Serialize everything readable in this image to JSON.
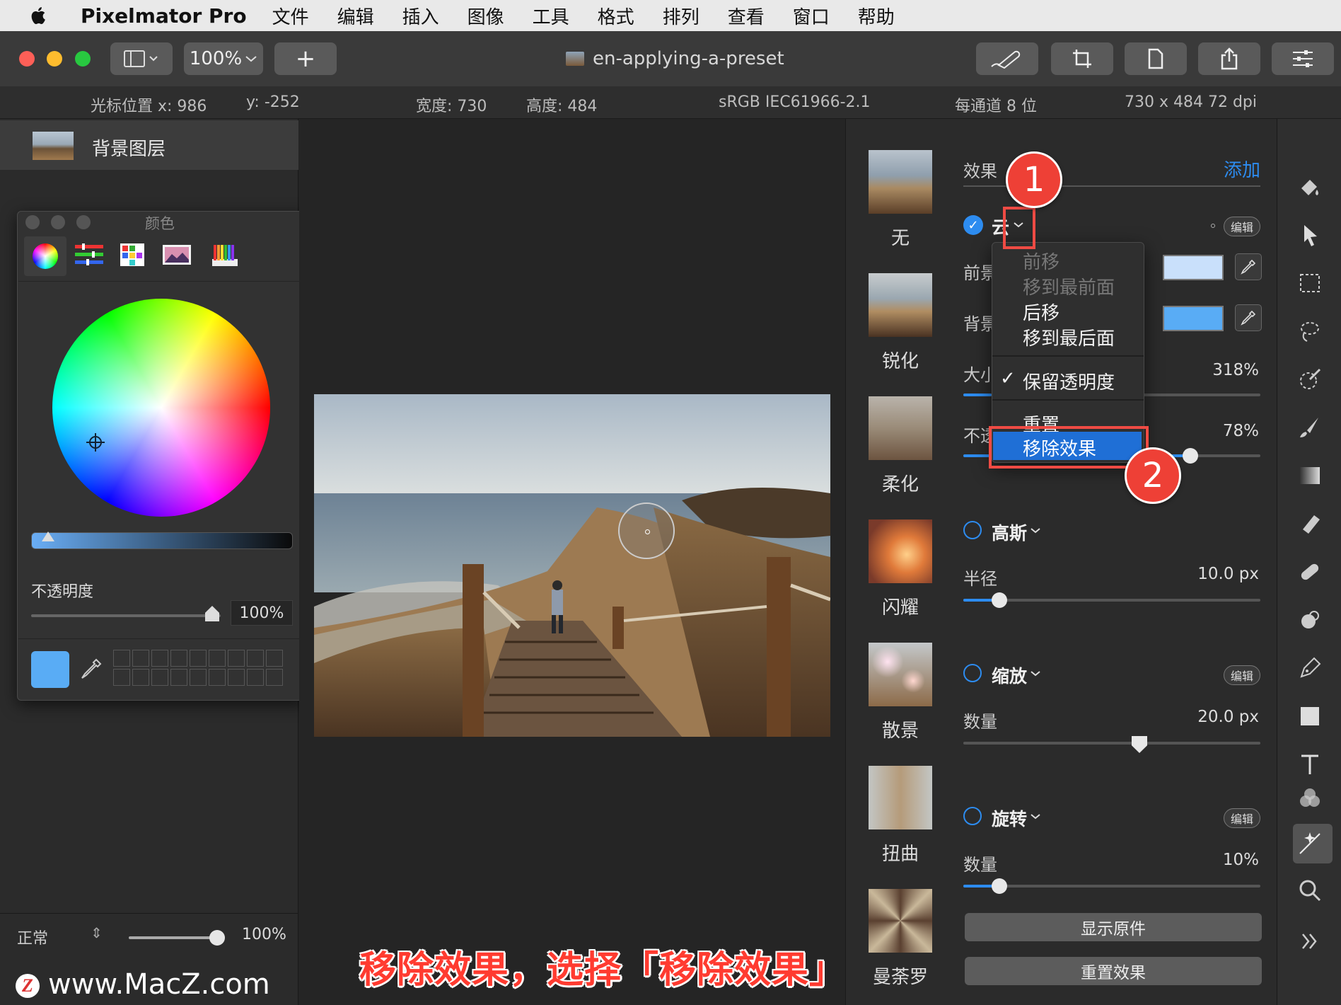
{
  "menubar": {
    "app_name": "Pixelmator Pro",
    "items": [
      "文件",
      "编辑",
      "插入",
      "图像",
      "工具",
      "格式",
      "排列",
      "查看",
      "窗口",
      "帮助"
    ]
  },
  "toolbar": {
    "zoom": "100%",
    "add_label": "+",
    "document_title": "en-applying-a-preset"
  },
  "infobar": {
    "cursor_x": "光标位置 x:  986",
    "cursor_y": "y:  -252",
    "width": "宽度:  730",
    "height": "高度:  484",
    "color_profile": "sRGB IEC61966-2.1",
    "bit_depth": "每通道 8 位",
    "dimensions": "730 x 484 72 dpi"
  },
  "layers": {
    "layer_name": "背景图层",
    "blend_mode": "正常",
    "layer_opacity": "100%",
    "layer_opacity_fraction": 1.0
  },
  "color_panel": {
    "title": "颜色",
    "opacity_label": "不透明度",
    "opacity_value": "100%",
    "opacity_fraction": 1.0,
    "current_color": "#59acf5"
  },
  "presets": [
    {
      "label": "无"
    },
    {
      "label": "锐化"
    },
    {
      "label": "柔化"
    },
    {
      "label": "闪耀"
    },
    {
      "label": "散景"
    },
    {
      "label": "扭曲"
    },
    {
      "label": "曼荼罗"
    }
  ],
  "effects": {
    "header_label": "效果",
    "add_label": "添加",
    "edit_badge": "编辑",
    "cloud": {
      "name_partial": "云",
      "fg_label_partial": "前景",
      "bg_label_partial": "背景",
      "size_label_partial": "大小",
      "size_value": "318%",
      "opacity_label_partial": "不透",
      "opacity_value": "78%",
      "fg_color": "#c9e0fb",
      "bg_color": "#59acf5"
    },
    "gaussian": {
      "name": "高斯",
      "param_label": "半径",
      "param_value": "10.0 px"
    },
    "zoom": {
      "name": "缩放",
      "param_label": "数量",
      "param_value": "20.0 px"
    },
    "twirl": {
      "name": "旋转",
      "param_label": "数量",
      "param_value": "10%"
    },
    "show_original": "显示原件",
    "reset_effects": "重置效果"
  },
  "context_menu": {
    "items": [
      {
        "label": "前移",
        "enabled": false
      },
      {
        "label": "移到最前面",
        "enabled": false
      },
      {
        "label": "后移",
        "enabled": true
      },
      {
        "label": "移到最后面",
        "enabled": true
      },
      {
        "label": "保留透明度",
        "enabled": true,
        "checked": true
      },
      {
        "label": "重置",
        "enabled": true
      },
      {
        "label": "移除效果",
        "enabled": true,
        "highlighted": true
      }
    ],
    "checkmark": "✓"
  },
  "annotations": {
    "step1": "1",
    "step2": "2",
    "caption": "移除效果，选择「移除效果」"
  },
  "watermark": {
    "logo_letter": "Z",
    "text": "www.MacZ.com"
  }
}
